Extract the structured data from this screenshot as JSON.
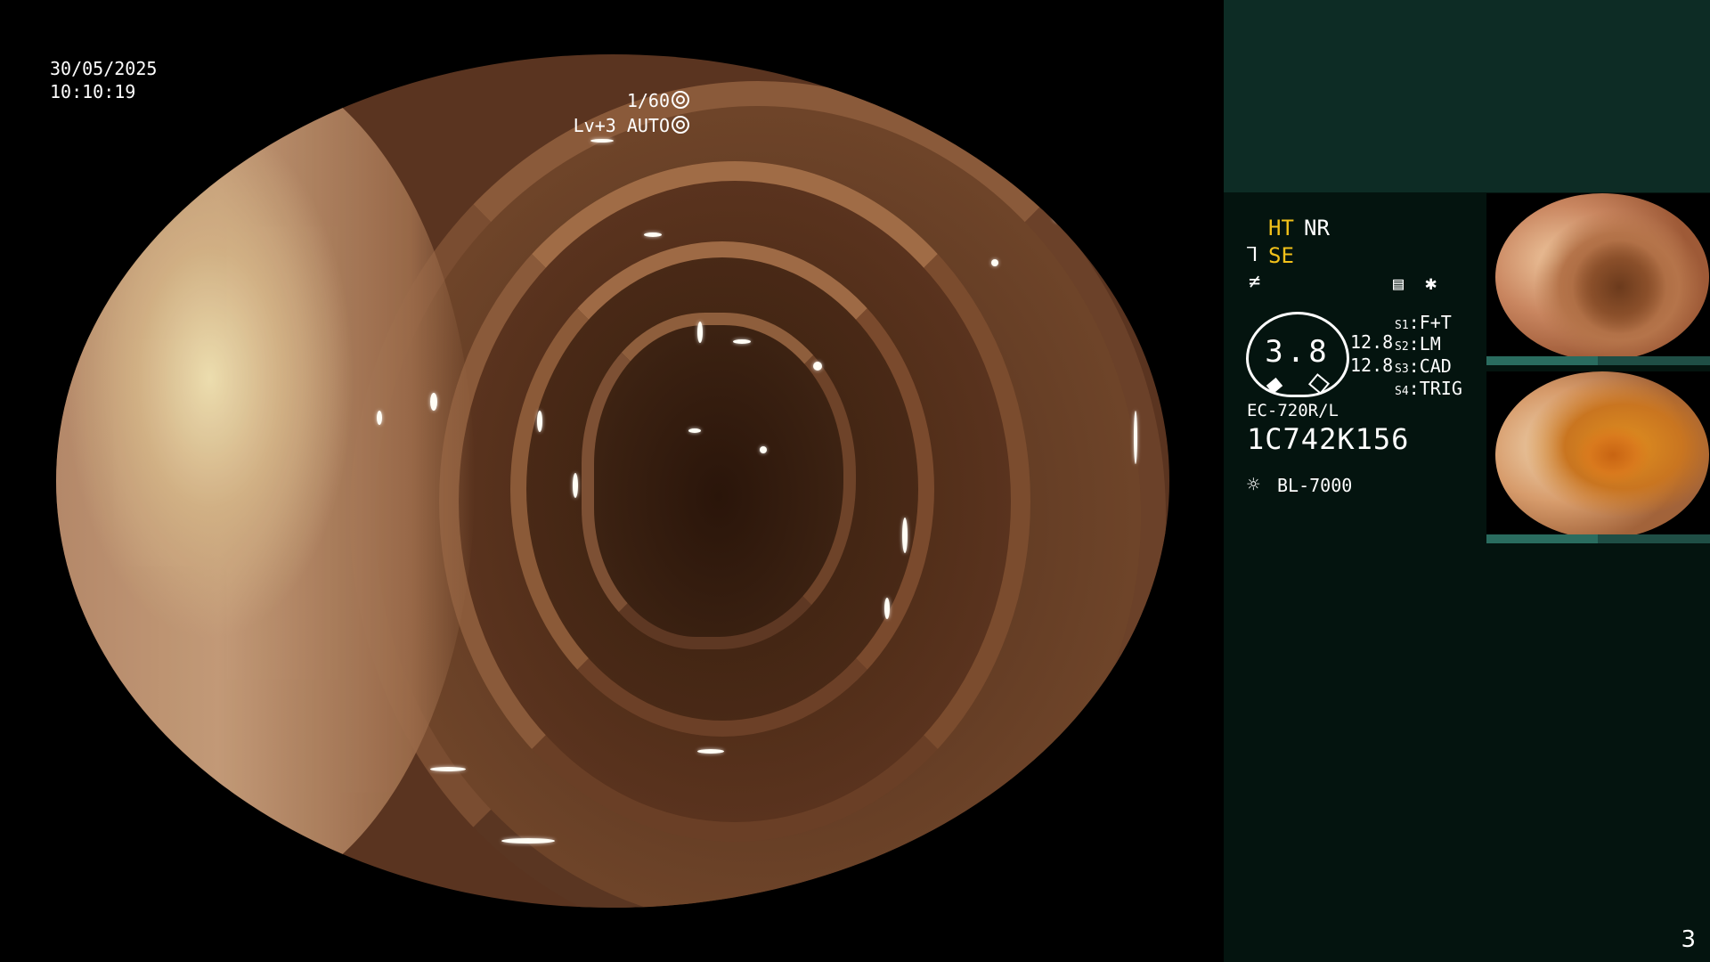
{
  "osd": {
    "date": "30/05/2025",
    "time": "10:10:19",
    "shutter": "1/60",
    "level": "Lv+3 AUTO"
  },
  "panel": {
    "modes": {
      "ht": "HT",
      "nr": "NR",
      "se": "SE"
    },
    "gauge_value": "3.8",
    "values": [
      "12.8",
      "12.8"
    ],
    "slots": [
      {
        "key": "S1",
        "value": "F+T"
      },
      {
        "key": "S2",
        "value": "LM"
      },
      {
        "key": "S3",
        "value": "CAD"
      },
      {
        "key": "S4",
        "value": "TRIG"
      }
    ],
    "scope_model": "EC-720R/L",
    "serial": "1C742K156",
    "light_source": "BL-7000",
    "colors": {
      "accent_yellow": "#f2c11a",
      "panel_bg": "#04140f",
      "panel_top_bg": "#0d2c25"
    },
    "icons": [
      "se-enhance-icon",
      "freeze-icon",
      "record-icon",
      "capture-star-icon",
      "light-source-icon"
    ]
  },
  "page_number": "3"
}
